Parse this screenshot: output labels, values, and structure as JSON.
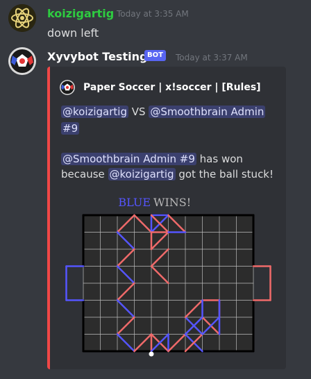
{
  "messages": [
    {
      "author": "koizigartig",
      "author_color": "#2ecc40",
      "timestamp": "Today at 3:35 AM",
      "content": "down left"
    },
    {
      "author": "Xyvybot Testing",
      "author_color": "#ffffff",
      "badge": "BOT",
      "timestamp": "Today at 3:37 AM",
      "embed": {
        "accent_color": "#f04747",
        "author": "Paper Soccer | x!soccer | [Rules]",
        "line1_mention_a": "@koizigartig",
        "line1_vs": "VS",
        "line1_mention_b": "@Smoothbrain Admin",
        "line2_mention_b_cont": "#9",
        "line3_mention": "@Smoothbrain Admin #9",
        "line3_text": "has won",
        "line4_text_a": "because",
        "line4_mention": "@koizigartig",
        "line4_text_b": "got the ball stuck!",
        "game": {
          "winner_word": "BLUE",
          "winner_suffix": "WINS!",
          "blue_color": "#5555ff",
          "red_color": "#f06a6a"
        }
      }
    }
  ]
}
